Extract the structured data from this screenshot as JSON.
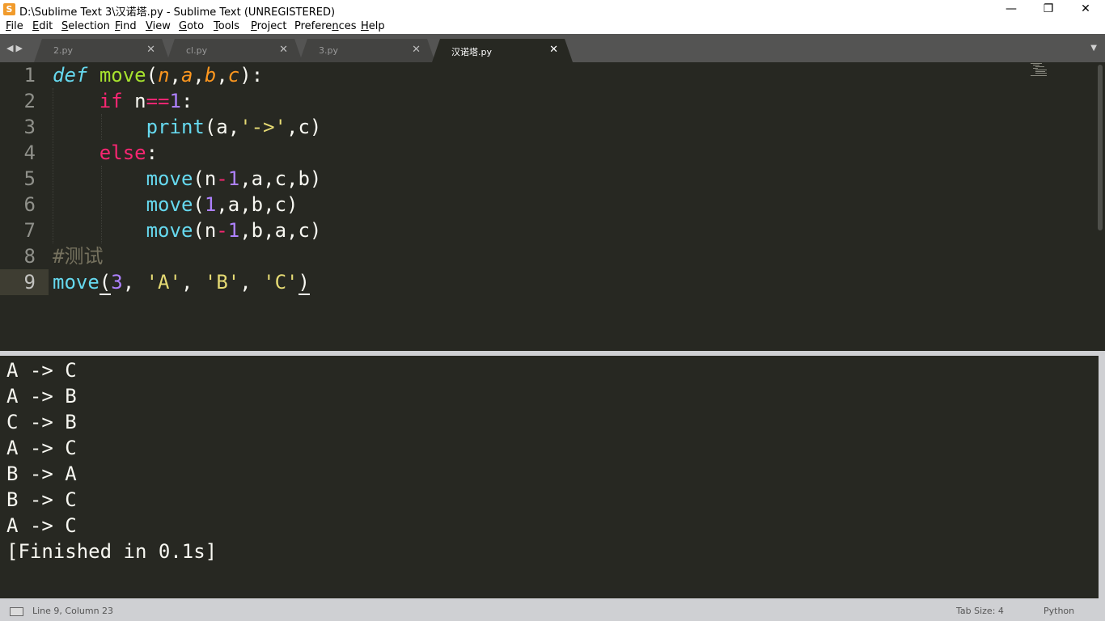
{
  "window": {
    "title": "D:\\Sublime Text 3\\汉诺塔.py - Sublime Text (UNREGISTERED)",
    "app_icon_glyph": "S",
    "minimize_glyph": "—",
    "maximize_glyph": "❐",
    "close_glyph": "✕"
  },
  "menu": [
    {
      "u": "F",
      "rest": "ile"
    },
    {
      "u": "E",
      "rest": "dit"
    },
    {
      "u": "S",
      "rest": "election"
    },
    {
      "u": "F",
      "rest": "ind"
    },
    {
      "u": "V",
      "rest": "iew"
    },
    {
      "u": "G",
      "rest": "oto"
    },
    {
      "u": "T",
      "rest": "ools"
    },
    {
      "u": "P",
      "rest": "roject"
    },
    {
      "pre": "Prefere",
      "u": "n",
      "rest": "ces"
    },
    {
      "u": "H",
      "rest": "elp"
    }
  ],
  "tabs": {
    "nav_arrows": "◀▶",
    "dropdown_glyph": "▼",
    "close_glyph": "✕",
    "items": [
      {
        "label": "2.py",
        "active": false
      },
      {
        "label": "cl.py",
        "active": false
      },
      {
        "label": "3.py",
        "active": false
      },
      {
        "label": "汉诺塔.py",
        "active": true
      }
    ]
  },
  "editor": {
    "line_numbers": [
      "1",
      "2",
      "3",
      "4",
      "5",
      "6",
      "7",
      "8",
      "9"
    ],
    "current_line": 9,
    "tokens": {
      "def": "def",
      "move": "move",
      "lp": "(",
      "rp": ")",
      "colon": ":",
      "comma": ",",
      "comma_sp": ", ",
      "n": "n",
      "a": "a",
      "b": "b",
      "c": "c",
      "if": "if",
      "eqeq": "==",
      "one": "1",
      "three": "3",
      "minus": "-",
      "print": "print",
      "arrow_str": "'->'",
      "else": "else",
      "comment": "#测试",
      "strA": "'A'",
      "strB": "'B'",
      "strC": "'C'"
    }
  },
  "output": {
    "lines": [
      "A -> C",
      "A -> B",
      "C -> B",
      "A -> C",
      "B -> A",
      "B -> C",
      "A -> C"
    ],
    "finished": "[Finished in 0.1s]"
  },
  "status": {
    "position": "Line 9, Column 23",
    "tab_size": "Tab Size: 4",
    "syntax": "Python"
  }
}
